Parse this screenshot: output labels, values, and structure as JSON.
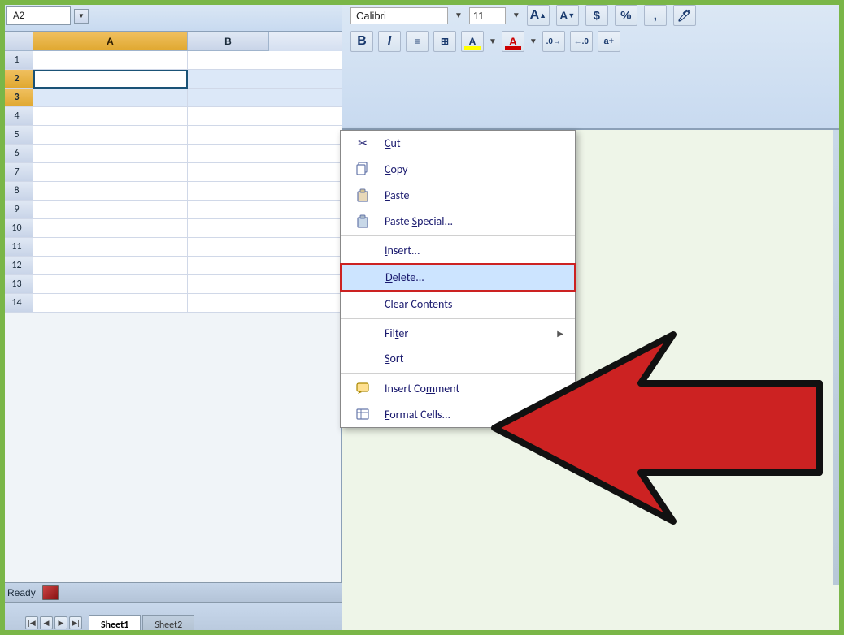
{
  "namebox": {
    "cell": "A2",
    "arrow": "▼"
  },
  "toolbar": {
    "font_name": "Calibri",
    "font_size": "11",
    "font_name_label": "Calibri",
    "font_size_label": "11"
  },
  "columns": {
    "a_label": "A",
    "b_label": "B"
  },
  "rows": [
    1,
    2,
    3,
    4,
    5,
    6,
    7,
    8,
    9,
    10,
    11,
    12,
    13,
    14
  ],
  "sheets": {
    "sheet1": "Sheet1",
    "sheet2": "Sheet2"
  },
  "statusbar": {
    "ready": "Ready"
  },
  "context_menu": {
    "items": [
      {
        "id": "cut",
        "label": "Cut",
        "underline_idx": 2,
        "has_icon": true,
        "has_arrow": false
      },
      {
        "id": "copy",
        "label": "Copy",
        "underline_idx": 0,
        "has_icon": true,
        "has_arrow": false
      },
      {
        "id": "paste",
        "label": "Paste",
        "underline_idx": 0,
        "has_icon": true,
        "has_arrow": false
      },
      {
        "id": "paste-special",
        "label": "Paste Special...",
        "underline_idx": 6,
        "has_icon": false,
        "has_arrow": false
      },
      {
        "id": "insert",
        "label": "Insert...",
        "underline_idx": 0,
        "has_icon": false,
        "has_arrow": false
      },
      {
        "id": "delete",
        "label": "Delete...",
        "underline_idx": 0,
        "has_icon": false,
        "has_arrow": false,
        "highlighted": true
      },
      {
        "id": "clear",
        "label": "Clear Contents",
        "underline_idx": 5,
        "has_icon": false,
        "has_arrow": false
      },
      {
        "id": "filter",
        "label": "Filter",
        "underline_idx": 5,
        "has_icon": false,
        "has_arrow": true
      },
      {
        "id": "sort",
        "label": "Sort",
        "underline_idx": 0,
        "has_icon": false,
        "has_arrow": false
      },
      {
        "id": "insert-comment",
        "label": "Insert Comment",
        "underline_idx": 7,
        "has_icon": true,
        "has_arrow": false
      },
      {
        "id": "format-cells",
        "label": "Format Cells...",
        "underline_idx": 0,
        "has_icon": false,
        "has_arrow": false
      }
    ]
  },
  "colors": {
    "accent_blue": "#1a1a6e",
    "selected_col": "#f0c060",
    "highlight": "#cce4ff",
    "delete_border": "#cc2222",
    "arrow_red": "#cc2222",
    "green_border": "#7ab648"
  }
}
